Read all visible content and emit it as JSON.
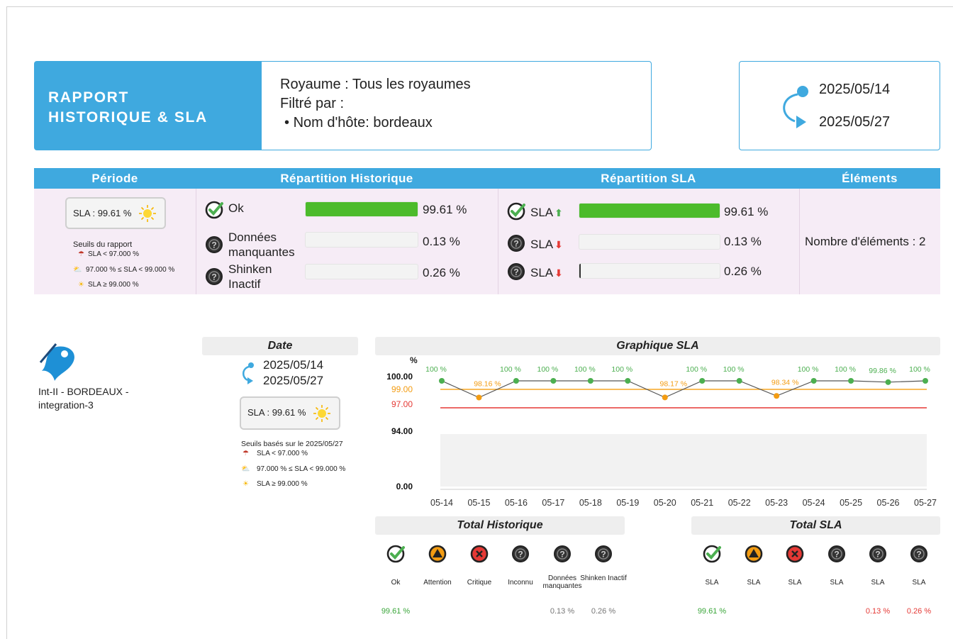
{
  "header": {
    "title_line1": "RAPPORT",
    "title_line2": "HISTORIQUE & SLA",
    "realm": "Royaume : Tous les royaumes",
    "filtered_by": "Filtré par :",
    "filter_item": "Nom d'hôte: bordeaux",
    "date_start": "2025/05/14",
    "date_end": "2025/05/27"
  },
  "summary": {
    "columns": [
      "Période",
      "Répartition Historique",
      "Répartition SLA",
      "Éléments"
    ],
    "period": {
      "sla_label": "SLA : 99.61 %",
      "thresholds_title": "Seuils du rapport",
      "thresholds": [
        "SLA < 97.000 %",
        "97.000 % ≤ SLA < 99.000 %",
        "SLA ≥ 99.000 %"
      ]
    },
    "history": [
      {
        "label": "Ok",
        "value": "99.61 %",
        "fill": 1.0
      },
      {
        "label": "Données manquantes",
        "value": "0.13 %",
        "fill": 0.0
      },
      {
        "label": "Shinken Inactif",
        "value": "0.26 %",
        "fill": 0.0
      }
    ],
    "sla": [
      {
        "label": "SLA",
        "arrow": "up",
        "value": "99.61 %",
        "fill": 1.0
      },
      {
        "label": "SLA",
        "arrow": "down",
        "value": "0.13 %",
        "fill": 0.0
      },
      {
        "label": "SLA",
        "arrow": "down",
        "value": "0.26 %",
        "fill": 0.01
      }
    ],
    "elements": "Nombre d'éléments : 2"
  },
  "host": {
    "name": "Int-II - BORDEAUX - integration-3",
    "date_header": "Date",
    "date_start": "2025/05/14",
    "date_end": "2025/05/27",
    "sla_label": "SLA : 99.61 %",
    "thresholds_title": "Seuils basés sur le 2025/05/27",
    "thresholds": [
      "SLA < 97.000 %",
      "97.000 % ≤ SLA < 99.000 %",
      "SLA ≥ 99.000 %"
    ]
  },
  "chart_data": {
    "type": "line",
    "title": "Graphique SLA",
    "ylabel": "%",
    "categories": [
      "05-14",
      "05-15",
      "05-16",
      "05-17",
      "05-18",
      "05-19",
      "05-20",
      "05-21",
      "05-22",
      "05-23",
      "05-24",
      "05-25",
      "05-26",
      "05-27"
    ],
    "values": [
      100,
      98.16,
      100,
      100,
      100,
      100,
      98.17,
      100,
      100,
      98.34,
      100,
      100,
      99.86,
      100
    ],
    "point_labels": [
      "100 %",
      "98.16 %",
      "100 %",
      "100 %",
      "100 %",
      "100 %",
      "98.17 %",
      "100 %",
      "100 %",
      "98.34 %",
      "100 %",
      "100 %",
      "99.86 %",
      "100 %"
    ],
    "y_ticks": [
      "100.00",
      "99.00",
      "97.00",
      "94.00",
      "0.00"
    ],
    "thresholds": [
      {
        "value": 99.0,
        "color": "#f5a623"
      },
      {
        "value": 97.0,
        "color": "#e53935"
      }
    ],
    "colors": {
      "ok": "#4caf50",
      "warn": "#f39c12",
      "line": "#555555"
    }
  },
  "totals_history": {
    "title": "Total Historique",
    "items": [
      {
        "icon": "check-icon",
        "label": "Ok",
        "value": "99.61 %",
        "color": "#3aa63a"
      },
      {
        "icon": "warning-icon",
        "label": "Attention",
        "value": "",
        "color": "#222"
      },
      {
        "icon": "critical-icon",
        "label": "Critique",
        "value": "",
        "color": "#222"
      },
      {
        "icon": "question-icon",
        "label": "Inconnu",
        "value": "",
        "color": "#222"
      },
      {
        "icon": "question-icon",
        "label": "Données manquantes",
        "value": "0.13 %",
        "color": "#777"
      },
      {
        "icon": "question-icon",
        "label": "Shinken Inactif",
        "value": "0.26 %",
        "color": "#777"
      }
    ]
  },
  "totals_sla": {
    "title": "Total SLA",
    "items": [
      {
        "icon": "check-icon",
        "label": "SLA",
        "value": "99.61 %",
        "color": "#3aa63a"
      },
      {
        "icon": "warning-icon",
        "label": "SLA",
        "value": "",
        "color": "#222"
      },
      {
        "icon": "critical-icon",
        "label": "SLA",
        "value": "",
        "color": "#222"
      },
      {
        "icon": "question-icon",
        "label": "SLA",
        "value": "",
        "color": "#222"
      },
      {
        "icon": "question-icon",
        "label": "SLA",
        "value": "0.13 %",
        "color": "#e53935"
      },
      {
        "icon": "question-icon",
        "label": "SLA",
        "value": "0.26 %",
        "color": "#e53935"
      }
    ]
  },
  "colors": {
    "accent": "#3fa9df",
    "ok_bar": "#4cbb2b",
    "panel_bg": "#f6ecf6"
  }
}
